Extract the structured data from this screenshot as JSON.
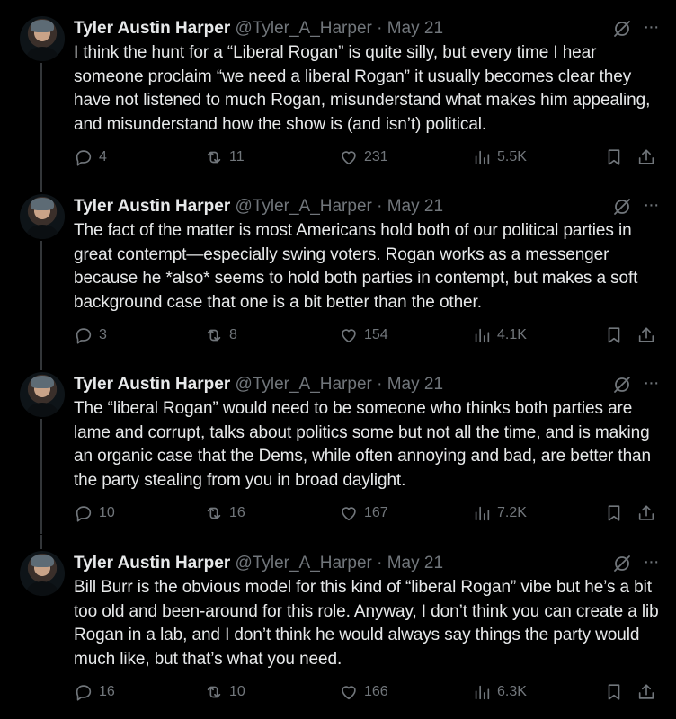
{
  "tweets": [
    {
      "name": "Tyler Austin Harper",
      "handle": "@Tyler_A_Harper",
      "separator": "·",
      "date": "May 21",
      "text": "I think the hunt for a “Liberal Rogan” is quite silly, but every time I hear someone proclaim “we need a liberal Rogan” it usually becomes clear they have not listened to much Rogan, misunderstand what makes him appealing, and misunderstand how the show is (and isn’t) political.",
      "replies": "4",
      "retweets": "11",
      "likes": "231",
      "views": "5.5K"
    },
    {
      "name": "Tyler Austin Harper",
      "handle": "@Tyler_A_Harper",
      "separator": "·",
      "date": "May 21",
      "text": "The fact of the matter is most Americans hold both of our political parties in great contempt—especially swing voters. Rogan works as a messenger because he *also* seems to hold both parties in contempt, but makes a soft background case that one is a bit better than the other.",
      "replies": "3",
      "retweets": "8",
      "likes": "154",
      "views": "4.1K"
    },
    {
      "name": "Tyler Austin Harper",
      "handle": "@Tyler_A_Harper",
      "separator": "·",
      "date": "May 21",
      "text": "The “liberal Rogan” would need to be someone who thinks both parties are lame and corrupt, talks about politics some but not all the time, and is making an organic case that the Dems, while often annoying and bad, are better than the party stealing from you in broad daylight.",
      "replies": "10",
      "retweets": "16",
      "likes": "167",
      "views": "7.2K"
    },
    {
      "name": "Tyler Austin Harper",
      "handle": "@Tyler_A_Harper",
      "separator": "·",
      "date": "May 21",
      "text": "Bill Burr is the obvious model for this kind of “liberal Rogan” vibe but he’s a bit too old and been-around for this role. Anyway, I don’t think you can create a lib Rogan in a lab, and I don’t think he would always say things the party would much like, but that’s what you need.",
      "replies": "16",
      "retweets": "10",
      "likes": "166",
      "views": "6.3K"
    }
  ],
  "more_label": "···",
  "icons": {
    "grok": "grok-icon",
    "more": "more-icon",
    "reply": "reply-icon",
    "retweet": "retweet-icon",
    "like": "heart-icon",
    "views": "views-icon",
    "bookmark": "bookmark-icon",
    "share": "share-icon"
  },
  "colors": {
    "background": "#000000",
    "text": "#e7e9ea",
    "muted": "#71767b",
    "thread_line": "#333639"
  }
}
